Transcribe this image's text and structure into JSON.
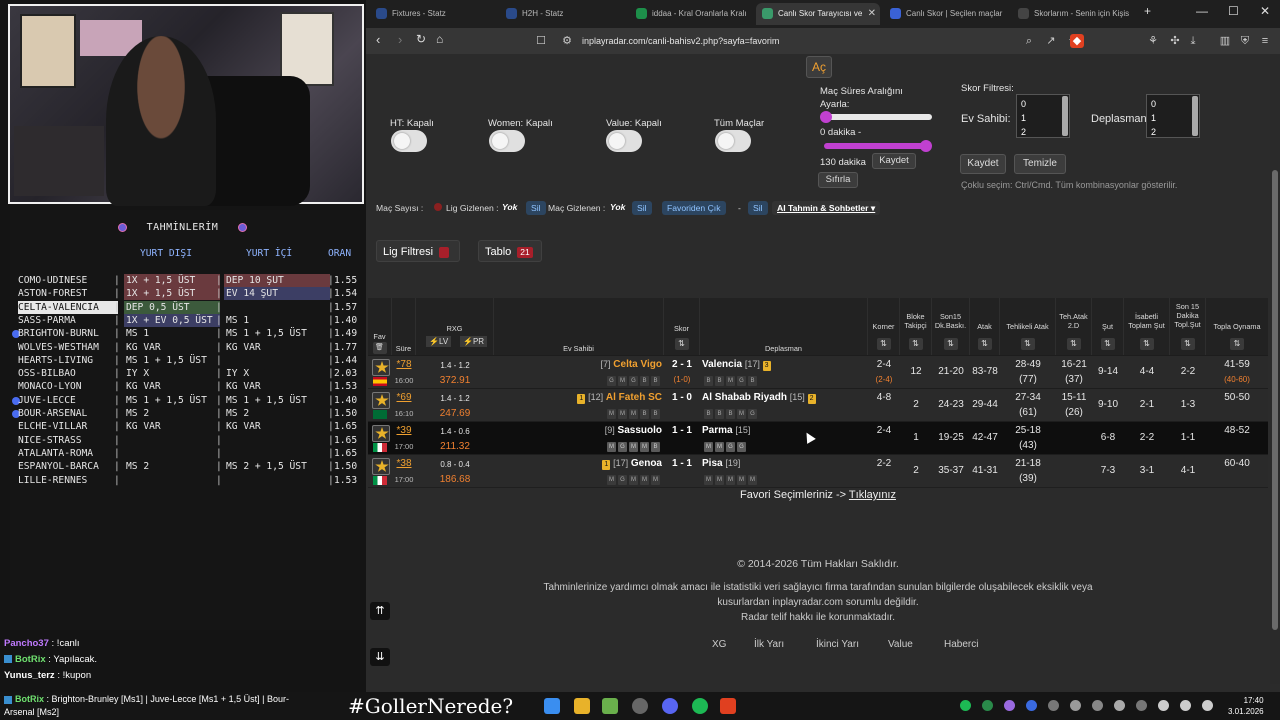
{
  "left": {
    "predictions_title": "TAHMİNLERİM",
    "col_abroad": "YURT DIŞI",
    "col_domestic": "YURT İÇİ",
    "col_odds": "ORAN",
    "rows": [
      {
        "match": "COMO-UDINESE",
        "a": "1X + 1,5 ÜST",
        "b": "DEP 10 ŞUT",
        "o": "1.55"
      },
      {
        "match": "ASTON-FOREST",
        "a": "1X + 1,5 ÜST",
        "b": "EV 14 ŞUT",
        "o": "1.54"
      },
      {
        "match": "CELTA-VALENCIA",
        "a": "DEP 0,5 ÜST",
        "b": "",
        "o": "1.57"
      },
      {
        "match": "SASS-PARMA",
        "a": "1X + EV 0,5 ÜST",
        "b": "MS 1",
        "o": "1.40"
      },
      {
        "match": "BRIGHTON-BURNL",
        "a": "MS 1",
        "b": "MS 1 + 1,5 ÜST",
        "o": "1.49"
      },
      {
        "match": "WOLVES-WESTHAM",
        "a": "KG VAR",
        "b": "KG VAR",
        "o": "1.77"
      },
      {
        "match": "HEARTS-LIVING",
        "a": "MS 1 + 1,5 ÜST",
        "b": "",
        "o": "1.44"
      },
      {
        "match": "OSS-BILBAO",
        "a": "IY X",
        "b": "IY X",
        "o": "2.03"
      },
      {
        "match": "MONACO-LYON",
        "a": "KG VAR",
        "b": "KG VAR",
        "o": "1.53"
      },
      {
        "match": "JUVE-LECCE",
        "a": "MS 1 + 1,5 ÜST",
        "b": "MS 1 + 1,5 ÜST",
        "o": "1.40"
      },
      {
        "match": "BOUR-ARSENAL",
        "a": "MS 2",
        "b": "MS 2",
        "o": "1.50"
      },
      {
        "match": "ELCHE-VILLAR",
        "a": "KG VAR",
        "b": "KG VAR",
        "o": "1.65"
      },
      {
        "match": "NICE-STRASS",
        "a": "",
        "b": "",
        "o": "1.65"
      },
      {
        "match": "ATALANTA-ROMA",
        "a": "",
        "b": "",
        "o": "1.65"
      },
      {
        "match": "ESPANYOL-BARCA",
        "a": "MS 2",
        "b": "MS 2 + 1,5 ÜST",
        "o": "1.50"
      },
      {
        "match": "LILLE-RENNES",
        "a": "",
        "b": "",
        "o": "1.53"
      }
    ],
    "chat": [
      {
        "user": "Pancho37",
        "msg": " : !canlı"
      },
      {
        "user": "BotRix",
        "msg": " : Yapılacak."
      },
      {
        "user": "Yunus_terz",
        "msg": " : !kupon"
      }
    ],
    "ticker_user": "BotRix",
    "ticker_line1": " : Brighton-Brunley [Ms1] | Juve-Lecce [Ms1 + 1,5 Üst] | Bour-",
    "ticker_line2": "Arsenal [Ms2]",
    "hashtag": "#GollerNerede?"
  },
  "browser": {
    "tabs": [
      {
        "label": "Fixtures - Statz",
        "color": "#2a4a8a"
      },
      {
        "label": "H2H - Statz",
        "color": "#2a4a8a"
      },
      {
        "label": "iddaa - Kral Oranlarla Kralı",
        "color": "#1d8f4a"
      },
      {
        "label": "Canlı Skor Tarayıcısı ve",
        "color": "#3a9a6a",
        "active": true
      },
      {
        "label": "Canlı Skor | Seçilen maçlar",
        "color": "#3a62d6"
      },
      {
        "label": "Skorlarım - Senin için Kişis",
        "color": "#444"
      }
    ],
    "url": "inplayradar.com/canli-bahisv2.php?sayfa=favorim"
  },
  "controls": {
    "open_btn": "Aç",
    "ht": "HT: Kapalı",
    "women": "Women: Kapalı",
    "value": "Value: Kapalı",
    "all": "Tüm Maçlar",
    "range_title": "Maç Süres Aralığını",
    "range_title2": "Ayarla:",
    "range_min": "0 dakika -",
    "range_max": "130 dakika",
    "save": "Kaydet",
    "reset": "Sıfırla",
    "score_filter": "Skor Filtresi:",
    "home": "Ev Sahibi:",
    "away": "Deplasman:",
    "list": [
      "0",
      "1",
      "2"
    ],
    "save2": "Kaydet",
    "clear": "Temizle",
    "hint": "Çoklu seçim: Ctrl/Cmd. Tüm kombinasyonlar gösterilir."
  },
  "filterbar": {
    "count_label": "Maç Sayısı :",
    "lig_hidden": "Lig Gizlenen :",
    "none1": "Yok",
    "sil1": "Sil",
    "mac_hidden": "Maç Gizlenen :",
    "none2": "Yok",
    "sil2": "Sil",
    "fav_out": "Favoriden Çık",
    "sep": "-",
    "sil3": "Sil",
    "ai": "AI Tahmin & Sohbetler"
  },
  "buttons": {
    "lig": "Lig Filtresi",
    "tablo": "Tablo",
    "tablo_count": "21"
  },
  "table": {
    "headers": {
      "fav": "Fav",
      "sure": "Süre",
      "rxg": "RXG",
      "lv": "LV",
      "pr": "PR",
      "home": "Ev Sahibi",
      "score": "Skor",
      "away": "Deplasman",
      "korner": "Korner",
      "bloke": "Bloke Takipçi",
      "son15": "Son15 Dk.Baskı.",
      "atak": "Atak",
      "tehlikeli": "Tehlikeli Atak",
      "teh2": "Teh.Atak 2.D",
      "sut": "Şut",
      "isabetli": "İsabetli Toplam Şut",
      "son15sut": "Son 15 Dakika Topl.Şut",
      "topla": "Topla Oynama"
    },
    "rows": [
      {
        "min": "*78",
        "time": "16:00",
        "xg": "1.4 - 1.2",
        "pr": "372.91",
        "hrank": "[7]",
        "home": "Celta Vigo",
        "hform": [
          "G",
          "M",
          "G",
          "B",
          "B"
        ],
        "score": "2 - 1",
        "ht": "(1-0)",
        "away": "Valencia",
        "arank": "[17]",
        "acard": "3",
        "aform": [
          "B",
          "B",
          "M",
          "G",
          "B"
        ],
        "korner": "2-4",
        "korner2": "(2-4)",
        "bloke": "12",
        "son15": "21-20",
        "atak": "83-78",
        "tehl": "28-49",
        "tehl2": "(77)",
        "teh2": "16-21",
        "teh22": "(37)",
        "sut": "9-14",
        "isab": "4-4",
        "s15": "2-2",
        "topla": "41-59",
        "topla2": "(40-60)",
        "flag": "es"
      },
      {
        "min": "*69",
        "time": "16:10",
        "xg": "1.4 - 1.2",
        "pr": "247.69",
        "hcard": "1",
        "hrank": "[12]",
        "home": "Al Fateh SC",
        "hform": [
          "M",
          "M",
          "M",
          "B",
          "B"
        ],
        "score": "1 - 0",
        "ht": "",
        "away": "Al Shabab Riyadh",
        "arank": "[15]",
        "acard": "2",
        "aform": [
          "B",
          "B",
          "B",
          "M",
          "G"
        ],
        "korner": "4-8",
        "korner2": "",
        "bloke": "2",
        "son15": "24-23",
        "atak": "29-44",
        "tehl": "27-34",
        "tehl2": "(61)",
        "teh2": "15-11",
        "teh22": "(26)",
        "sut": "9-10",
        "isab": "2-1",
        "s15": "1-3",
        "topla": "50-50",
        "topla2": "",
        "flag": "sa"
      },
      {
        "min": "*39",
        "time": "17:00",
        "xg": "1.4 - 0.6",
        "pr": "211.32",
        "hrank": "[9]",
        "home": "Sassuolo",
        "hform": [
          "M",
          "G",
          "M",
          "M",
          "B"
        ],
        "score": "1 - 1",
        "ht": "",
        "away": "Parma",
        "arank": "[15]",
        "aform": [
          "M",
          "M",
          "G",
          "G"
        ],
        "korner": "2-4",
        "korner2": "",
        "bloke": "1",
        "son15": "19-25",
        "atak": "42-47",
        "tehl": "25-18",
        "tehl2": "(43)",
        "teh2": "",
        "teh22": "",
        "sut": "6-8",
        "isab": "2-2",
        "s15": "1-1",
        "topla": "48-52",
        "topla2": "",
        "flag": "it"
      },
      {
        "min": "*38",
        "time": "17:00",
        "xg": "0.8 - 0.4",
        "pr": "186.68",
        "hcard": "1",
        "hrank": "[17]",
        "home": "Genoa",
        "hform": [
          "M",
          "G",
          "M",
          "M",
          "M"
        ],
        "score": "1 - 1",
        "ht": "",
        "away": "Pisa",
        "arank": "[19]",
        "aform": [
          "M",
          "M",
          "M",
          "M",
          "M"
        ],
        "korner": "2-2",
        "korner2": "",
        "bloke": "2",
        "son15": "35-37",
        "atak": "41-31",
        "tehl": "21-18",
        "tehl2": "(39)",
        "teh2": "",
        "teh22": "",
        "sut": "7-3",
        "isab": "3-1",
        "s15": "4-1",
        "topla": "60-40",
        "topla2": "",
        "flag": "it"
      }
    ],
    "fav_note": "Favori Seçimleriniz ->",
    "fav_link": "Tıklayınız"
  },
  "footer": {
    "copy": "© 2014-2026 Tüm Hakları Saklıdır.",
    "disc1": "Tahminlerinize yardımcı olmak amacı ile istatistiki veri sağlayıcı firma tarafından sunulan bilgilerde oluşabilecek eksiklik veya",
    "disc2": "kusurlardan inplayradar.com sorumlu değildir.",
    "disc3": "Radar telif hakkı ile korunmaktadır.",
    "links": [
      "XG",
      "İlk Yarı",
      "İkinci Yarı",
      "Value",
      "Haberci"
    ]
  },
  "clock": {
    "time": "17:40",
    "date": "3.01.2026"
  }
}
